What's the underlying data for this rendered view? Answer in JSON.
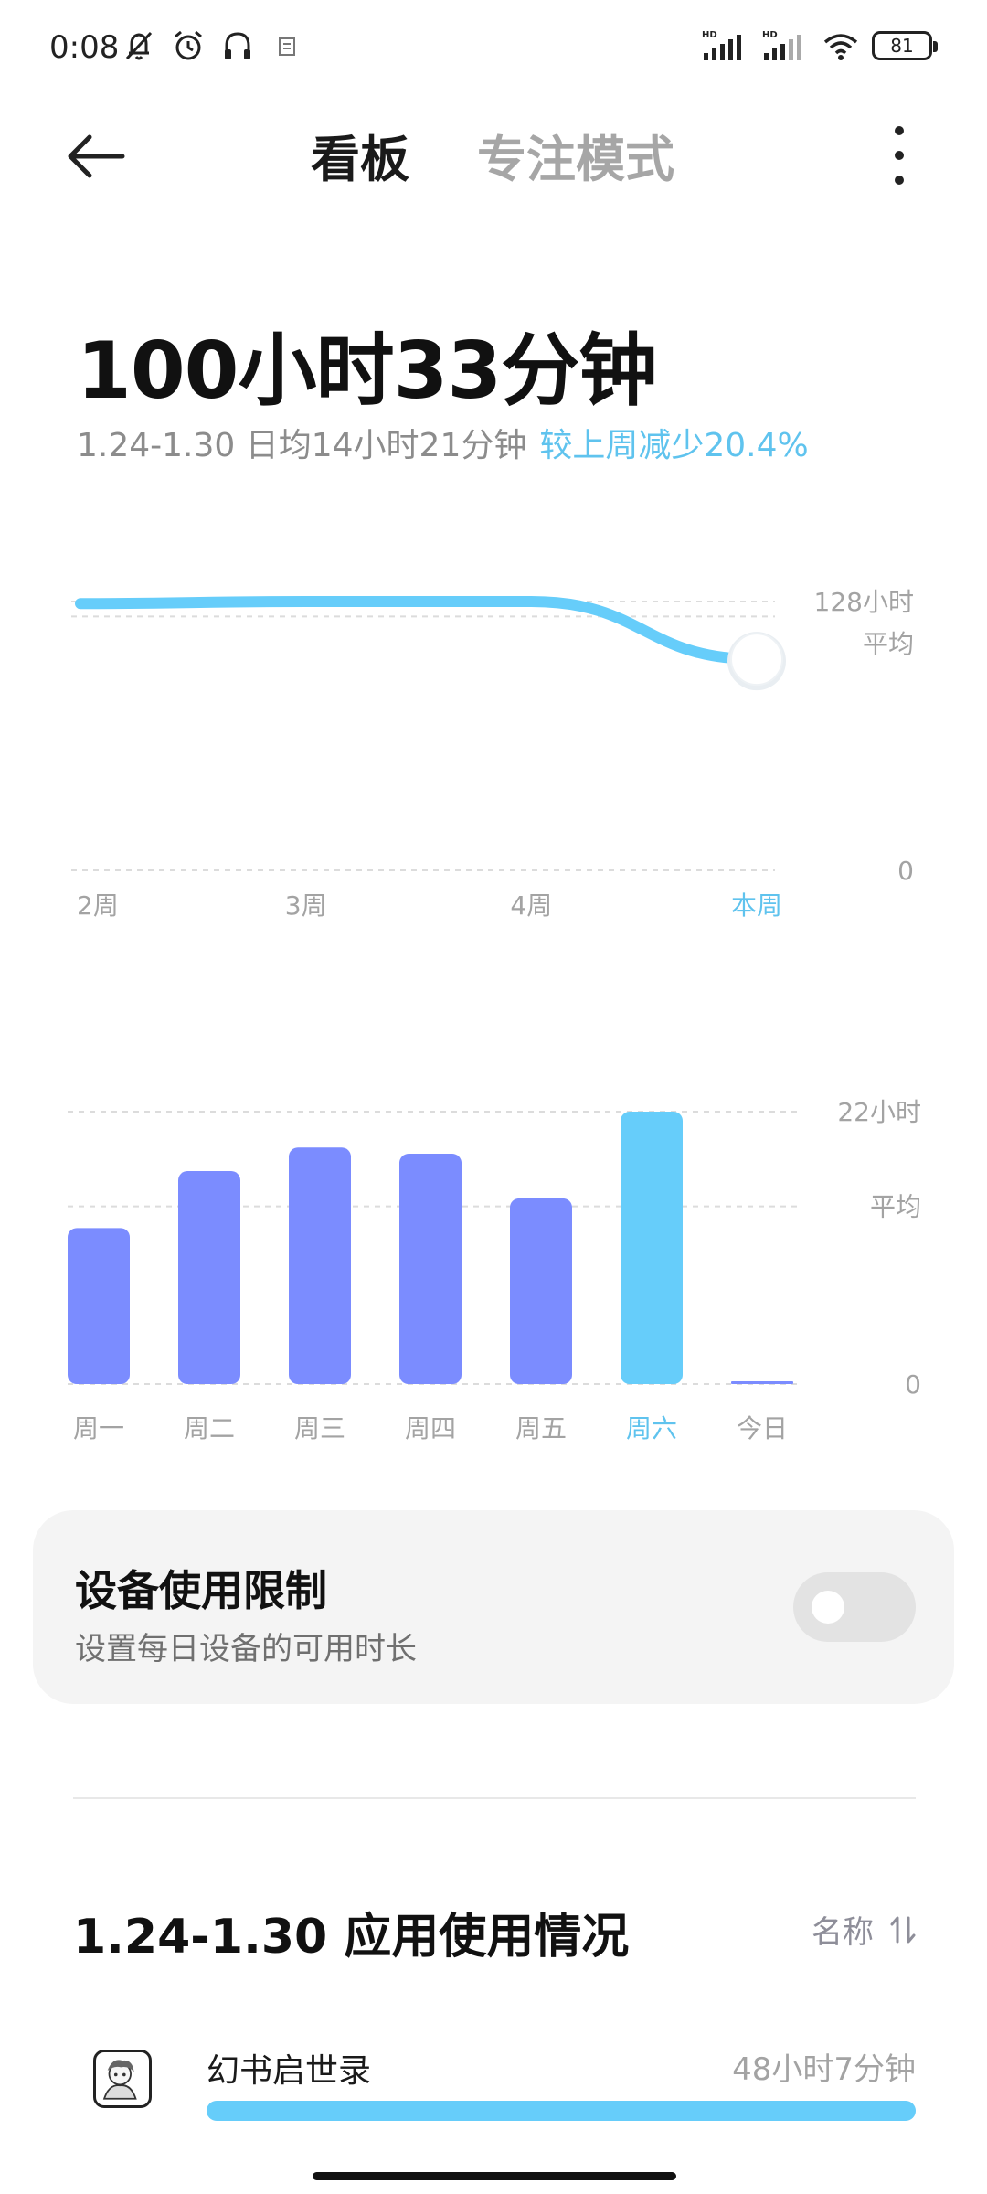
{
  "status_bar": {
    "time": "0:08",
    "left_icons": [
      "bell-off-icon",
      "alarm-icon",
      "headphones-icon",
      "notification-icon"
    ],
    "right_icons": [
      "signal-hd-1-icon",
      "signal-hd-2-icon",
      "wifi-icon"
    ],
    "battery": "81"
  },
  "header": {
    "tabs": [
      {
        "label": "看板",
        "active": true
      },
      {
        "label": "专注模式",
        "active": false
      }
    ]
  },
  "summary": {
    "total": "100小时33分钟",
    "range_avg": "1.24-1.30 日均14小时21分钟",
    "change": "较上周减少20.4%"
  },
  "chart_data": [
    {
      "type": "line",
      "x": [
        "2周",
        "3周",
        "4周",
        "本周"
      ],
      "series": [
        {
          "values": [
            127,
            128,
            128,
            100.5
          ]
        }
      ],
      "ylim": [
        0,
        128
      ],
      "max_label": "128小时",
      "avg_label": "平均",
      "zero_label": "0",
      "highlight_index": 3,
      "colors": {
        "line": "#66cdfa",
        "highlight": "#5fc3ee",
        "grid": "#dcdcdc"
      }
    },
    {
      "type": "bar",
      "categories": [
        "周一",
        "周二",
        "周三",
        "周四",
        "周五",
        "周六",
        "今日"
      ],
      "values": [
        12.6,
        17.2,
        19.1,
        18.6,
        15.0,
        22.0,
        0.1
      ],
      "ylim": [
        0,
        22
      ],
      "max_label": "22小时",
      "avg_label": "平均",
      "average": 14.35,
      "zero_label": "0",
      "highlight_index": 5,
      "colors": {
        "bar": "#7b8cff",
        "highlight": "#66cdfa",
        "grid": "#dcdcdc"
      }
    }
  ],
  "limit_card": {
    "title": "设备使用限制",
    "description": "设置每日设备的可用时长",
    "enabled": false
  },
  "apps": {
    "title": "1.24-1.30 应用使用情况",
    "sort_label": "名称",
    "items": [
      {
        "name": "幻书启世录",
        "time": "48小时7分钟",
        "fraction": 1.0
      }
    ]
  }
}
